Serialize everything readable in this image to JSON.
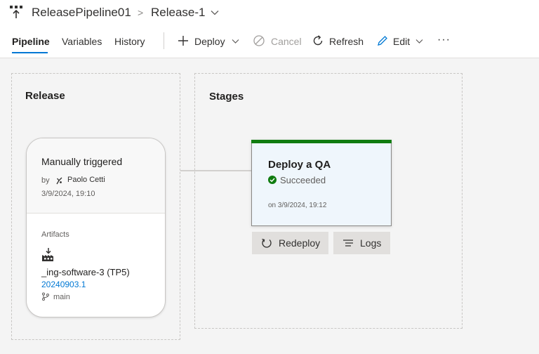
{
  "breadcrumb": {
    "pipeline_icon": "release-pipeline-icon",
    "pipeline_name": "ReleasePipeline01",
    "separator": ">",
    "release_name": "Release-1"
  },
  "tabs": [
    {
      "label": "Pipeline",
      "selected": true
    },
    {
      "label": "Variables",
      "selected": false
    },
    {
      "label": "History",
      "selected": false
    }
  ],
  "toolbar": {
    "deploy_label": "Deploy",
    "cancel_label": "Cancel",
    "refresh_label": "Refresh",
    "edit_label": "Edit",
    "more_label": "···"
  },
  "release_section": {
    "title": "Release",
    "trigger": "Manually triggered",
    "by_label": "by",
    "by_name": "Paolo Cetti",
    "date": "3/9/2024, 19:10",
    "artifacts_label": "Artifacts",
    "artifact_icon": "build-artifact-icon",
    "artifact_name": "_ing-software-3 (TP5)",
    "artifact_build": "20240903.1",
    "artifact_branch": "main"
  },
  "stages_section": {
    "title": "Stages",
    "stage": {
      "name": "Deploy a QA",
      "status": "Succeeded",
      "date": "on 3/9/2024, 19:12",
      "status_color": "#107c10",
      "redeploy_label": "Redeploy",
      "logs_label": "Logs"
    }
  },
  "colors": {
    "accent": "#0078d4",
    "success": "#107c10",
    "stage_bg": "#eff6fc",
    "canvas_bg": "#f4f4f4"
  }
}
